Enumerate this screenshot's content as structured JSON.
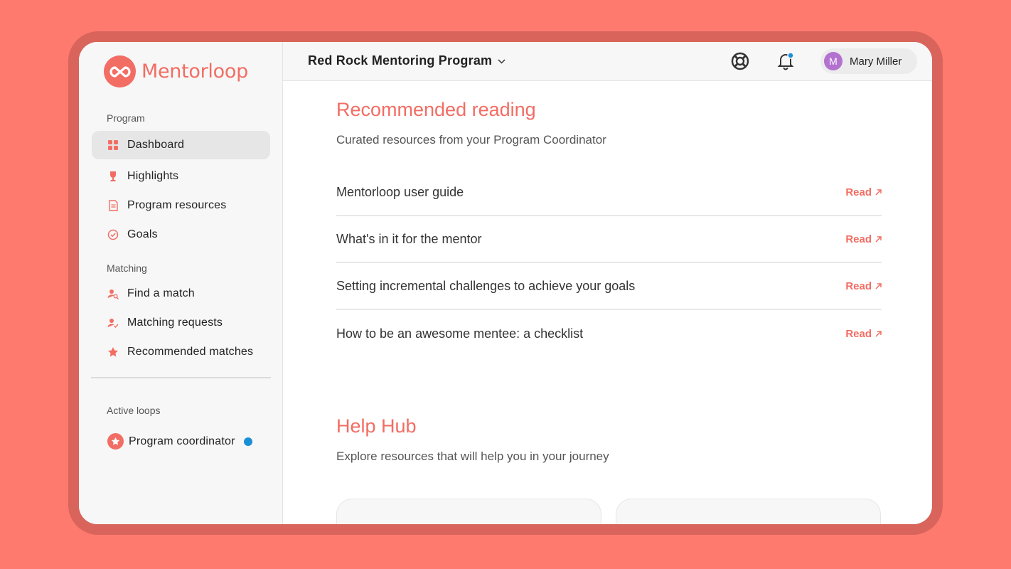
{
  "brand": {
    "name": "Mentorloop",
    "color": "#f26d63"
  },
  "header": {
    "program_name": "Red Rock Mentoring Program",
    "user": {
      "initial": "M",
      "name": "Mary Miller"
    }
  },
  "sidebar": {
    "program_label": "Program",
    "program_items": [
      {
        "label": "Dashboard",
        "icon": "dashboard-icon",
        "active": true
      },
      {
        "label": "Highlights",
        "icon": "trophy-icon"
      },
      {
        "label": "Program resources",
        "icon": "document-icon"
      },
      {
        "label": "Goals",
        "icon": "check-circle-icon"
      }
    ],
    "matching_label": "Matching",
    "matching_items": [
      {
        "label": "Find a match",
        "icon": "person-search-icon"
      },
      {
        "label": "Matching requests",
        "icon": "person-check-icon"
      },
      {
        "label": "Recommended matches",
        "icon": "star-icon"
      }
    ],
    "active_loops_label": "Active loops",
    "loops": [
      {
        "label": "Program coordinator",
        "icon": "star-badge-icon"
      }
    ]
  },
  "reading": {
    "title": "Recommended reading",
    "subtitle": "Curated resources from your Program Coordinator",
    "items": [
      {
        "title": "Mentorloop user guide",
        "action": "Read"
      },
      {
        "title": "What's in it for the mentor",
        "action": "Read"
      },
      {
        "title": "Setting incremental challenges to achieve your goals",
        "action": "Read"
      },
      {
        "title": "How to be an awesome mentee: a checklist",
        "action": "Read"
      }
    ]
  },
  "help_hub": {
    "title": "Help Hub",
    "subtitle": "Explore resources that will help you in your journey"
  }
}
